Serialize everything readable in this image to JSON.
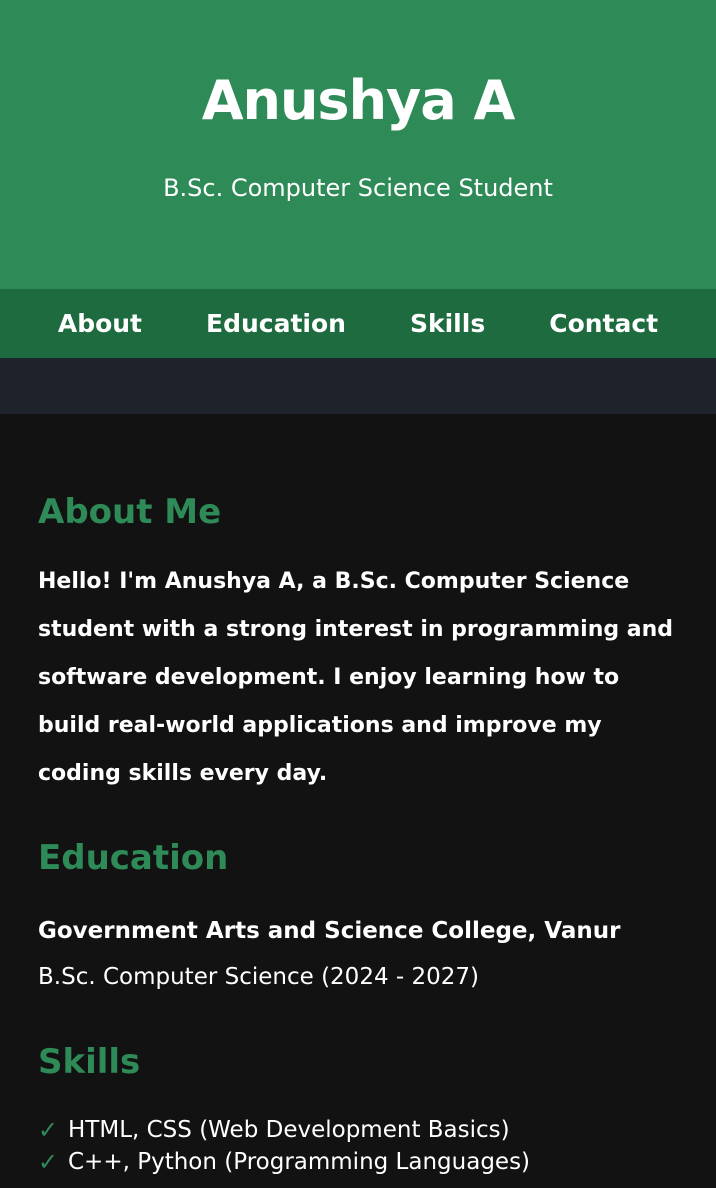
{
  "header": {
    "name": "Anushya A",
    "subtitle": "B.Sc. Computer Science Student"
  },
  "nav": {
    "items": [
      {
        "label": "About"
      },
      {
        "label": "Education"
      },
      {
        "label": "Skills"
      },
      {
        "label": "Contact"
      }
    ]
  },
  "about": {
    "title": "About Me",
    "text": "Hello! I'm Anushya A, a B.Sc. Computer Science student with a strong interest in programming and software development. I enjoy learning how to build real-world applications and improve my coding skills every day."
  },
  "education": {
    "title": "Education",
    "college": "Government Arts and Science College, Vanur",
    "degree": "B.Sc. Computer Science (2024 - 2027)"
  },
  "skills": {
    "title": "Skills",
    "check_glyph": "✓",
    "items": [
      "HTML, CSS (Web Development Basics)",
      "C++, Python (Programming Languages)"
    ]
  },
  "colors": {
    "accent": "#2e8b57",
    "nav_bg": "#1e6b40",
    "band_bg": "#1e222b",
    "page_bg": "#121212"
  }
}
